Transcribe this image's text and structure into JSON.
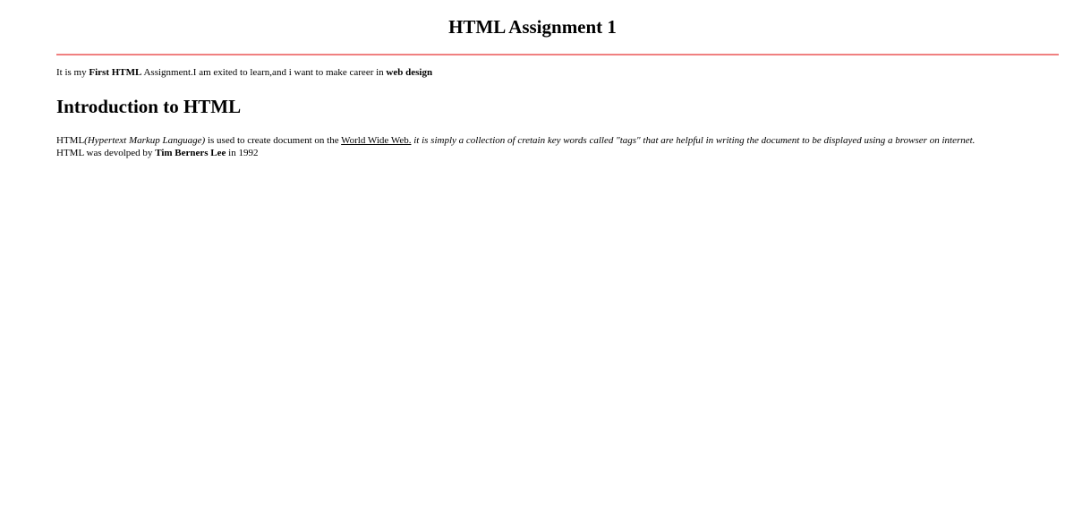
{
  "header": {
    "title": "HTML Assignment 1",
    "rule_color": "#f08080"
  },
  "intro": {
    "text_1": "It is my ",
    "bold_1": "First HTML",
    "text_2": " Assignment.I am exited to learn,and i want to make career in ",
    "bold_2": "web design"
  },
  "section": {
    "heading": "Introduction to HTML",
    "paragraph": {
      "text_1": "HTML",
      "italic_1": "(Hypertext Markup Language)",
      "text_2": " is used to create document on the ",
      "link": "World Wide Web.",
      "italic_2": " it is simply a collection of cretain key words called \"tags\" that are helpful in writing the document to be displayed using a browser on internet.",
      "text_3": "HTML was devolped by ",
      "bold_1": "Tim Berners Lee",
      "text_4": " in 1992"
    }
  }
}
